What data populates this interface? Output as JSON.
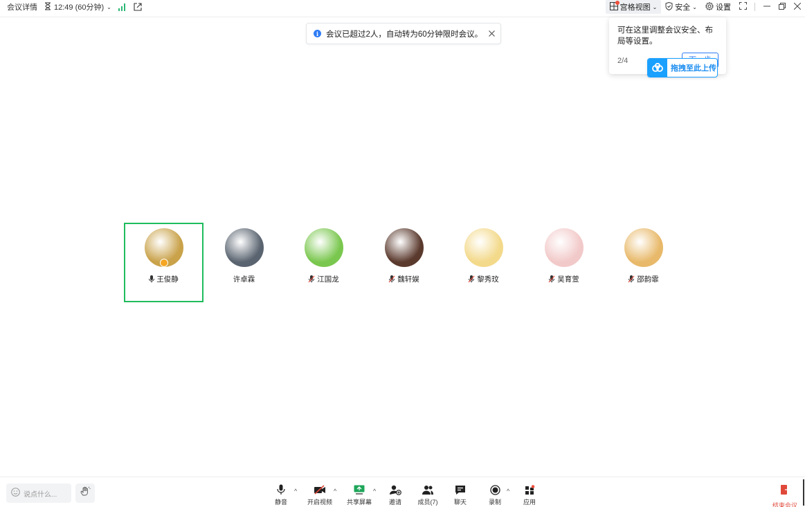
{
  "topbar": {
    "meeting_details": "会议详情",
    "timer": "12:49 (60分钟)",
    "grid_view": "宫格视图",
    "security": "安全",
    "settings": "设置"
  },
  "notice": {
    "text": "会议已超过2人，自动转为60分钟限时会议。"
  },
  "tooltip": {
    "text": "可在这里调整会议安全、布局等设置。",
    "step": "2/4",
    "next_label": "下一步"
  },
  "upload": {
    "label": "拖拽至此上传"
  },
  "participants": [
    {
      "name": "王俊静",
      "mic": "on",
      "host": true,
      "active": true,
      "avatar_color": "#c9a24a"
    },
    {
      "name": "许卓霖",
      "mic": "none",
      "host": false,
      "active": false,
      "avatar_color": "#5a6470"
    },
    {
      "name": "江国龙",
      "mic": "off",
      "host": false,
      "active": false,
      "avatar_color": "#7ac74f"
    },
    {
      "name": "魏轩娱",
      "mic": "off",
      "host": false,
      "active": false,
      "avatar_color": "#5b3a2e"
    },
    {
      "name": "黎秀玟",
      "mic": "off",
      "host": false,
      "active": false,
      "avatar_color": "#f3d98a"
    },
    {
      "name": "吴育萱",
      "mic": "off",
      "host": false,
      "active": false,
      "avatar_color": "#f2c9c9"
    },
    {
      "name": "邵韵霏",
      "mic": "off",
      "host": false,
      "active": false,
      "avatar_color": "#e8b96a"
    }
  ],
  "bottombar": {
    "chat_placeholder": "说点什么...",
    "mute": "静音",
    "video": "开启视频",
    "share": "共享屏幕",
    "invite": "邀请",
    "members": "成员(7)",
    "chat": "聊天",
    "record": "录制",
    "apps": "应用",
    "end": "结束会议"
  },
  "colors": {
    "accent": "#2f7cf6",
    "speaking_border": "#1ebc5c",
    "end_red": "#e0483a",
    "signal_green": "#2bb673"
  }
}
